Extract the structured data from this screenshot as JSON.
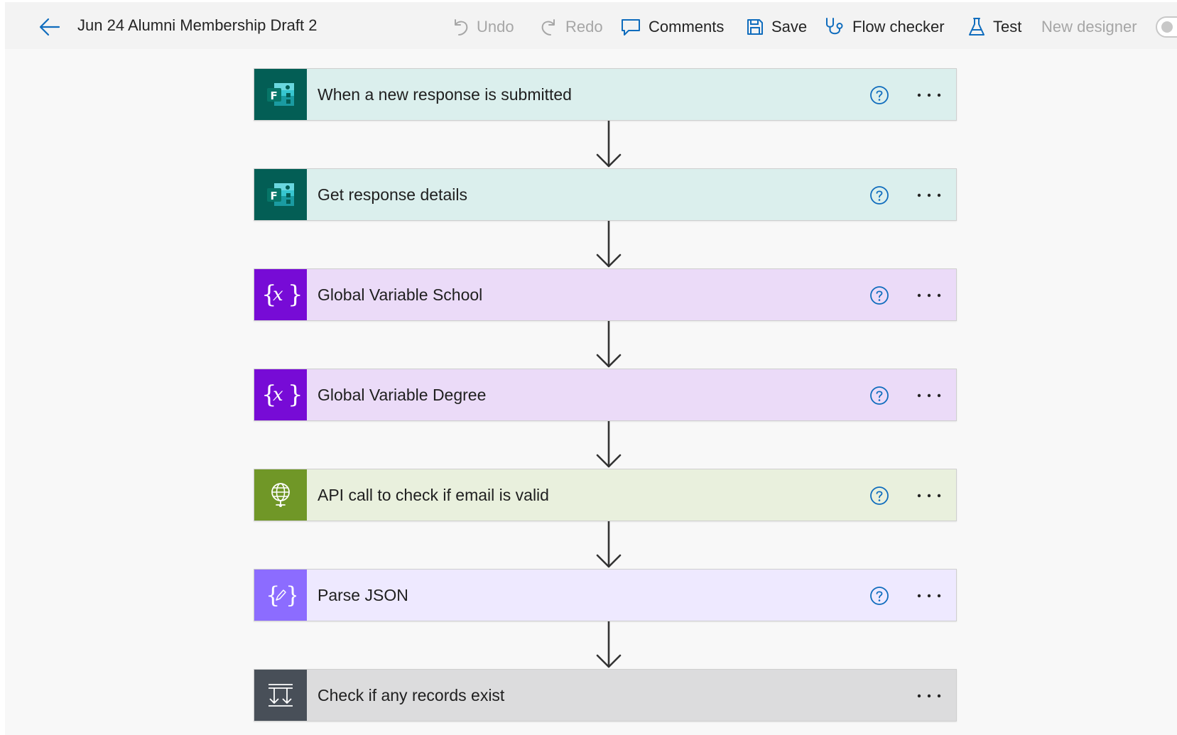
{
  "header": {
    "title": "Jun 24 Alumni Membership Draft 2",
    "undo_label": "Undo",
    "redo_label": "Redo",
    "comments_label": "Comments",
    "save_label": "Save",
    "flow_checker_label": "Flow checker",
    "test_label": "Test",
    "new_designer_label": "New designer"
  },
  "colors": {
    "accent": "#0f6cbd",
    "forms_icon_bg": "#035e55",
    "forms_card_bg": "#dbefed",
    "variable_icon_bg": "#770bd6",
    "variable_card_bg": "#ebdbf8",
    "http_icon_bg": "#709727",
    "http_card_bg": "#e9f0dd",
    "json_icon_bg": "#8c6cff",
    "json_card_bg": "#eee9ff",
    "condition_icon_bg": "#484f58",
    "condition_card_bg": "#dcdcdd"
  },
  "steps": [
    {
      "label": "When a new response is submitted",
      "icon": "forms-icon"
    },
    {
      "label": "Get response details",
      "icon": "forms-icon"
    },
    {
      "label": "Global Variable School",
      "icon": "variable-icon"
    },
    {
      "label": "Global Variable Degree",
      "icon": "variable-icon"
    },
    {
      "label": "API call to check if email is valid",
      "icon": "http-globe-icon"
    },
    {
      "label": "Parse JSON",
      "icon": "parse-json-icon"
    },
    {
      "label": "Check if any records exist",
      "icon": "condition-icon"
    }
  ]
}
